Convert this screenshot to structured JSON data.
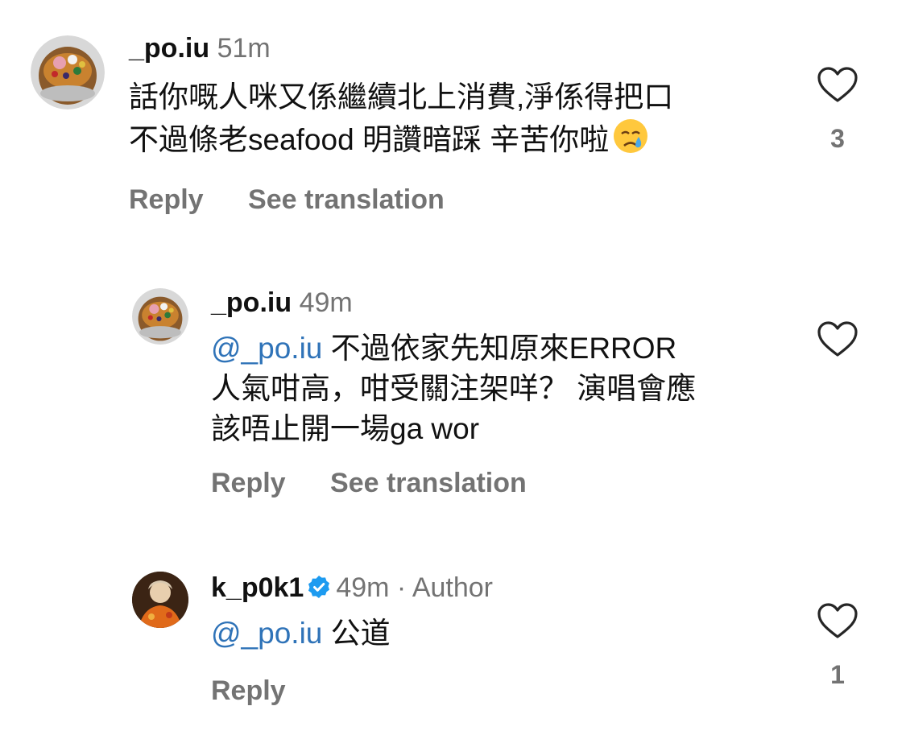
{
  "comments": [
    {
      "username": "_po.iu",
      "time": "51m",
      "text_line1": "話你嘅人咪又係繼續北上消費,淨係得把口",
      "text_line2": "不過條老seafood 明讚暗踩 辛苦你啦",
      "emoji": "crying-face",
      "reply_label": "Reply",
      "translate_label": "See translation",
      "like_count": "3"
    },
    {
      "username": "_po.iu",
      "time": "49m",
      "mention": "@_po.iu",
      "text_line1": " 不過依家先知原來ERROR",
      "text_line2": "人氣咁高，咁受關注架咩？ 演唱會應",
      "text_line3": "該唔止開一場ga wor",
      "reply_label": "Reply",
      "translate_label": "See translation"
    },
    {
      "username": "k_p0k1",
      "time": "49m",
      "separator": "·",
      "author_label": "Author",
      "verified": true,
      "mention": "@_po.iu",
      "text": " 公道",
      "reply_label": "Reply",
      "like_count": "1"
    }
  ],
  "colors": {
    "text": "#111111",
    "secondary": "#737373",
    "mention": "#2f73b8",
    "verified": "#1d9bf0"
  }
}
